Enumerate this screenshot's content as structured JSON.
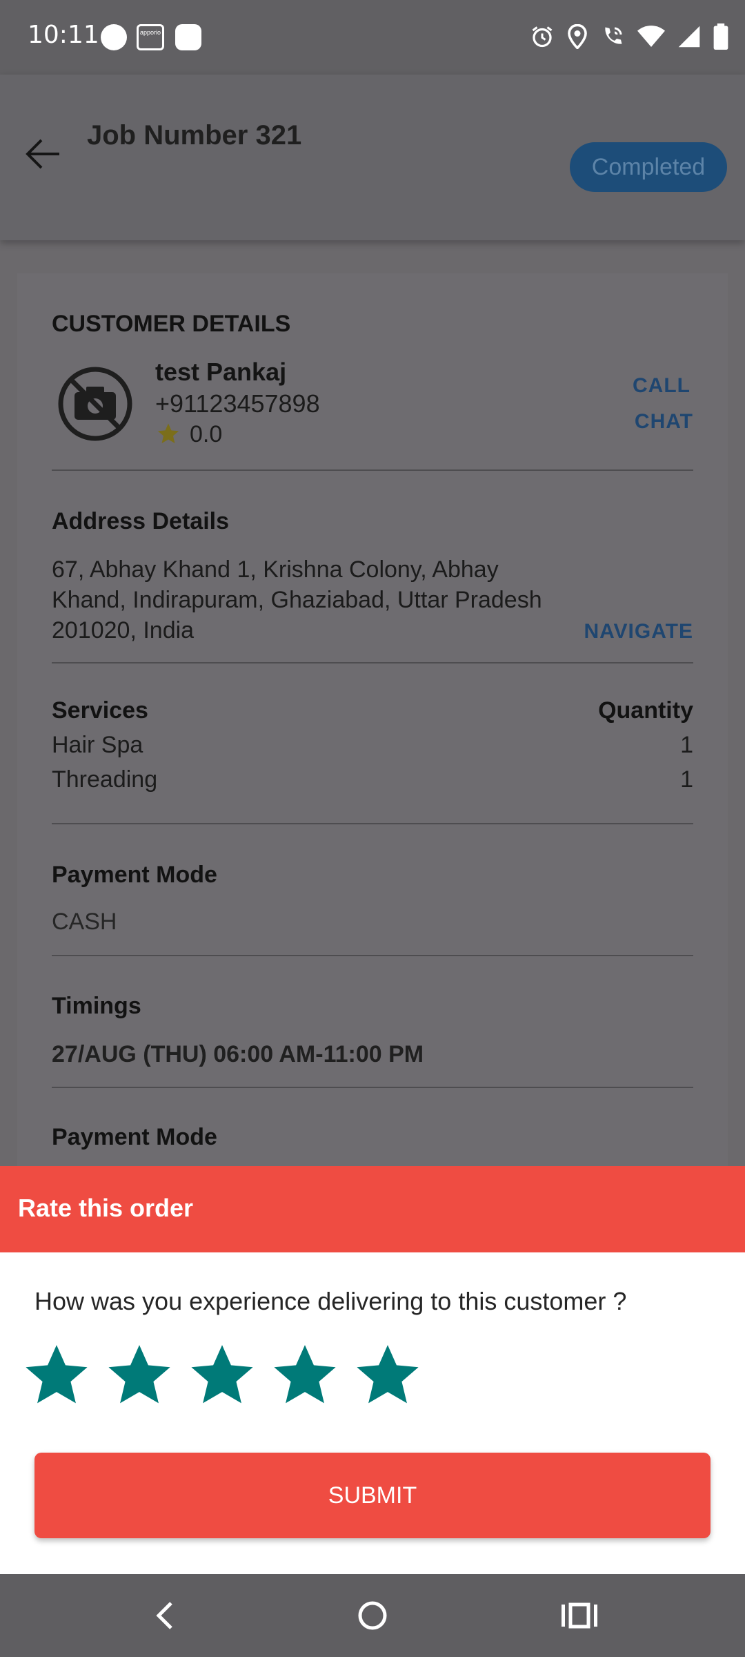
{
  "status_bar": {
    "time": "10:11",
    "app_icon_text": "apporio"
  },
  "header": {
    "title": "Job Number 321",
    "status": "Completed"
  },
  "customer": {
    "section_title": "CUSTOMER DETAILS",
    "name": "test Pankaj",
    "phone": "+91123457898",
    "rating": "0.0",
    "call_label": "CALL",
    "chat_label": "CHAT"
  },
  "address": {
    "section_title": "Address Details",
    "line1": "67, Abhay Khand 1, Krishna Colony, Abhay",
    "line2": "Khand, Indirapuram, Ghaziabad, Uttar Pradesh",
    "line3": "201020, India",
    "navigate_label": "NAVIGATE"
  },
  "services": {
    "header_label": "Services",
    "quantity_label": "Quantity",
    "items": [
      {
        "name": "Hair Spa",
        "qty": "1"
      },
      {
        "name": "Threading",
        "qty": "1"
      }
    ]
  },
  "payment": {
    "section_title": "Payment Mode",
    "value": "CASH"
  },
  "timings": {
    "section_title": "Timings",
    "value": "27/AUG (THU) 06:00 AM-11:00 PM"
  },
  "payment2": {
    "section_title": "Payment Mode"
  },
  "rating_sheet": {
    "title": "Rate this order",
    "question": "How was you experience delivering to this customer ?",
    "stars_selected": 5,
    "stars_total": 5,
    "submit_label": "SUBMIT",
    "star_color": "#007a78",
    "accent_color": "#ef4c42"
  }
}
